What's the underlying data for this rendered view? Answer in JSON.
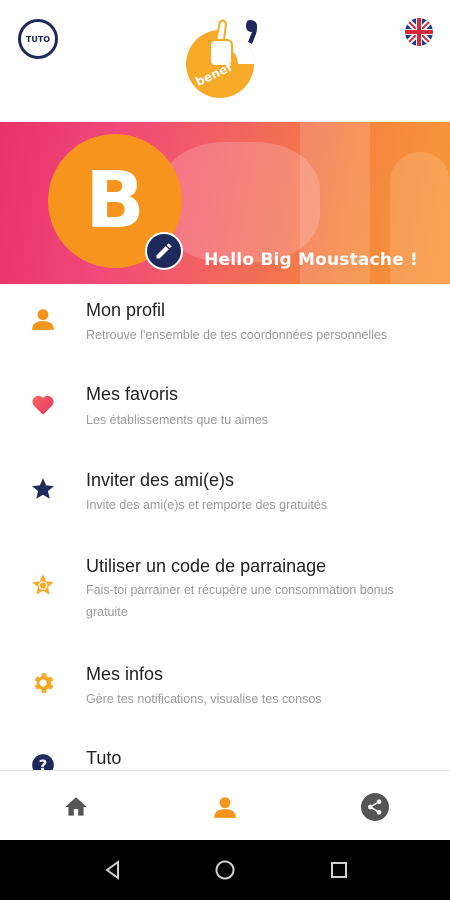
{
  "header": {
    "tuto_label": "TUTO",
    "logo_text": "benef",
    "language": "English"
  },
  "banner": {
    "avatar_initial": "B",
    "greeting": "Hello Big Moustache !"
  },
  "menu": [
    {
      "icon": "person-icon",
      "title": "Mon profil",
      "desc": "Retrouve l'ensemble de tes coordonnées personnelles"
    },
    {
      "icon": "heart-icon",
      "title": "Mes favoris",
      "desc": "Les établissements que tu aimes"
    },
    {
      "icon": "star-icon",
      "title": "Inviter des ami(e)s",
      "desc": "Invite des ami(e)s et remporte des gratuités"
    },
    {
      "icon": "badge-star-icon",
      "title": "Utiliser un code de parrainage",
      "desc": "Fais-toi parrainer et récupère une consommation bonus gratuite"
    },
    {
      "icon": "gear-icon",
      "title": "Mes infos",
      "desc": "Gère tes notifications, visualise tes consos"
    },
    {
      "icon": "help-icon",
      "title": "Tuto",
      "desc": ""
    }
  ],
  "bottom_nav": [
    {
      "icon": "home-icon",
      "active": false
    },
    {
      "icon": "person-icon",
      "active": true
    },
    {
      "icon": "share-icon",
      "active": false
    }
  ],
  "colors": {
    "orange": "#f7941d",
    "navy": "#1f2a5c",
    "pink": "#e8326a",
    "gray_text": "#9a9a9a"
  }
}
